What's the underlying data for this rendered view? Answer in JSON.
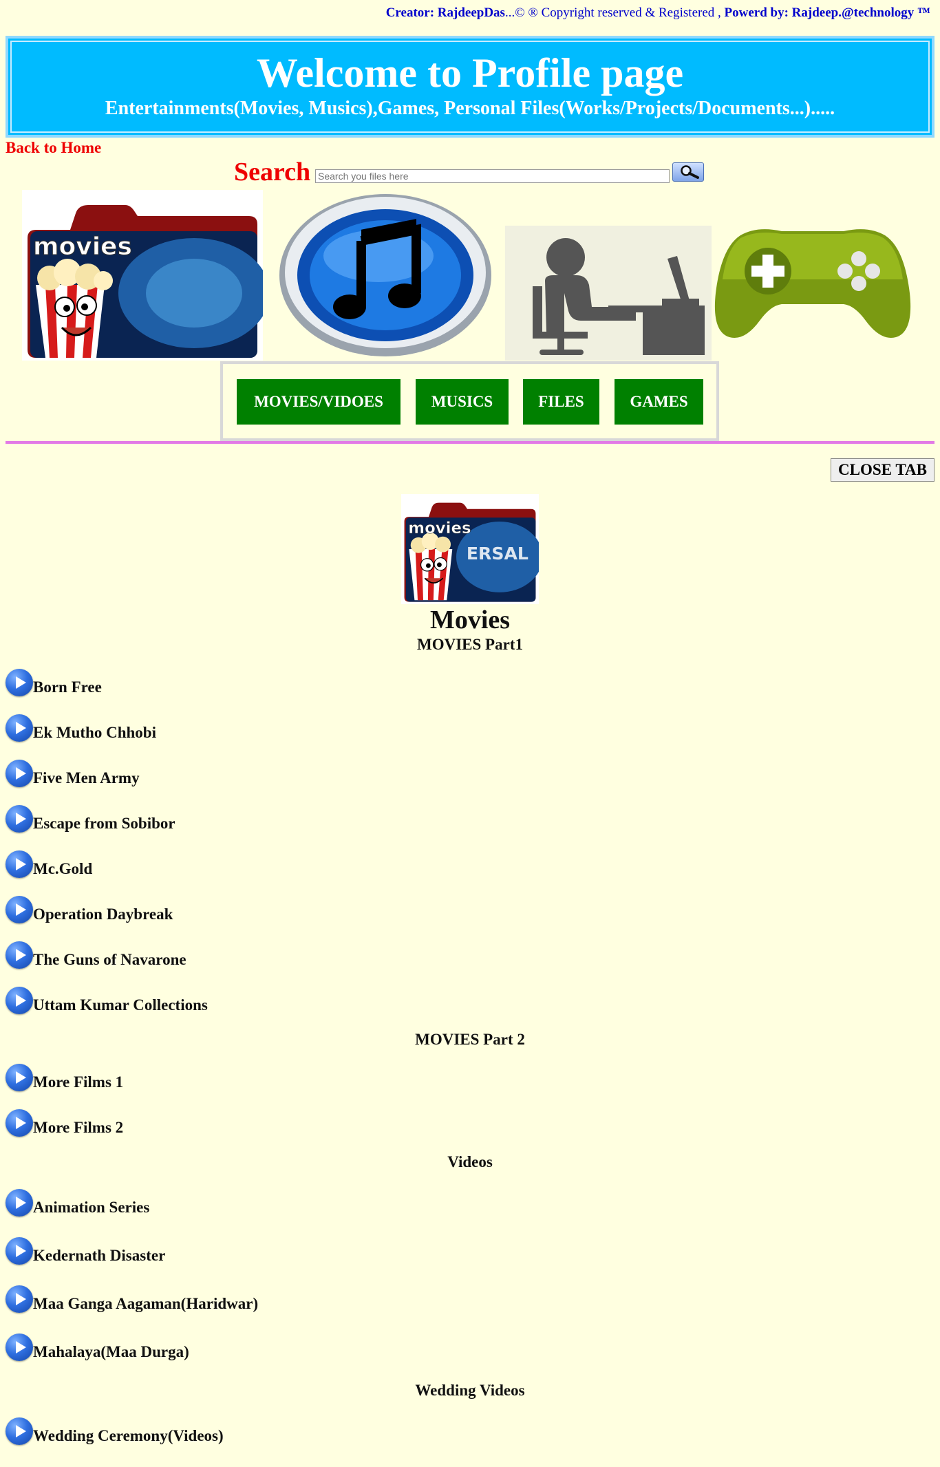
{
  "credits": {
    "creator_label": "Creator: RajdeepDas",
    "copyright_text": "...© ® Copyright reserved & Registered ,",
    "powered_label": "Powerd by: Rajdeep.@technology ™"
  },
  "banner": {
    "title": "Welcome to Profile page",
    "subtitle": "Entertainments(Movies, Musics),Games, Personal Files(Works/Projects/Documents...)....."
  },
  "back_link": "Back to Home",
  "search": {
    "label": "Search",
    "placeholder": "Search you files here",
    "button_icon": "magnifier-icon"
  },
  "tiles": [
    {
      "name": "movies-tile",
      "text": "movies",
      "text2": "ERSAL"
    },
    {
      "name": "music-tile"
    },
    {
      "name": "files-tile"
    },
    {
      "name": "games-tile"
    }
  ],
  "nav": [
    "MOVIES/VIDOES",
    "MUSICS",
    "FILES",
    "GAMES"
  ],
  "colors": {
    "nav_green": "#008000",
    "banner_blue": "#00bbff",
    "accent_red": "#ee0000",
    "page_bg": "#ffffe0"
  },
  "close_tab": "CLOSE TAB",
  "panel": {
    "title": "Movies",
    "sections": [
      {
        "heading": "MOVIES Part1",
        "items": [
          "Born Free",
          "Ek Mutho Chhobi",
          "Five Men Army",
          "Escape from Sobibor",
          "Mc.Gold",
          "Operation Daybreak",
          "The Guns of Navarone",
          "Uttam Kumar Collections"
        ]
      },
      {
        "heading": "MOVIES Part 2",
        "items": [
          "More Films 1",
          "More Films 2"
        ]
      },
      {
        "heading": "Videos",
        "items": [
          "Animation Series",
          "Kedernath Disaster",
          "Maa Ganga Aagaman(Haridwar)",
          "Mahalaya(Maa Durga)"
        ]
      },
      {
        "heading": "Wedding Videos",
        "items": [
          "Wedding Ceremony(Videos)"
        ]
      }
    ]
  }
}
